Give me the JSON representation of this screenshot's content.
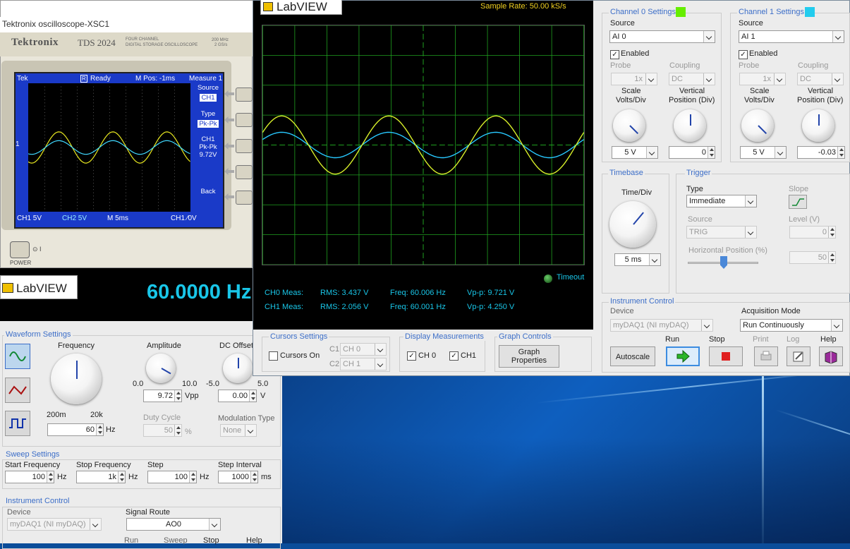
{
  "tek": {
    "window_title": "Tektronix oscilloscope-XSC1",
    "brand": "Tektronix",
    "model": "TDS 2024",
    "model_sub1": "FOUR CHANNEL",
    "model_sub2": "DIGITAL STORAGE OSCILLOSCOPE",
    "spec1": "200 MHz",
    "spec2": "2 GS/s",
    "top_left": "Tek",
    "status": "Ready",
    "mpos": "M Pos: -1ms",
    "measure": "Measure 1",
    "source_lbl": "Source",
    "source_val": "CH1",
    "type_lbl": "Type",
    "type_val": "Pk-Pk",
    "ch1_lbl": "CH1",
    "ch1_type": "Pk-Pk",
    "ch1_val": "9.72V",
    "back": "Back",
    "ch1_scale": "CH1 5V",
    "ch2_scale": "CH2 5V",
    "time_scale": "M 5ms",
    "trig": "CH1 ∕0V",
    "marker": "1",
    "power": "POWER"
  },
  "fgen": {
    "logo": "LabVIEW",
    "freq_display": "60.0000 Hz",
    "waveform_title": "Waveform Settings",
    "frequency_lbl": "Frequency",
    "freq_min": "200m",
    "freq_max": "20k",
    "freq_val": "60",
    "freq_unit": "Hz",
    "amp_lbl": "Amplitude",
    "amp_min": "0.0",
    "amp_max": "10.0",
    "amp_val": "9.72",
    "amp_unit": "Vpp",
    "dc_lbl": "DC Offset",
    "dc_min": "-5.0",
    "dc_max": "5.0",
    "dc_val": "0.00",
    "dc_unit": "V",
    "duty_lbl": "Duty Cycle",
    "duty_val": "50",
    "duty_unit": "%",
    "mod_lbl": "Modulation Type",
    "mod_val": "None",
    "sweep_title": "Sweep Settings",
    "start_lbl": "Start Frequency",
    "start_val": "100",
    "stop_lbl": "Stop Frequency",
    "stop_val": "1k",
    "step_lbl": "Step",
    "step_val": "100",
    "interval_lbl": "Step Interval",
    "interval_val": "1000",
    "hz": "Hz",
    "ms": "ms",
    "ic_title": "Instrument Control",
    "device_lbl": "Device",
    "device_val": "myDAQ1 (NI myDAQ)",
    "route_lbl": "Signal Route",
    "route_val": "AO0",
    "run": "Run",
    "sweep": "Sweep",
    "stop": "Stop",
    "help": "Help"
  },
  "scope": {
    "logo": "LabVIEW",
    "sample_rate": "Sample Rate:  50.00 kS/s",
    "timeout": "Timeout",
    "ch0_meas": "CH0 Meas:",
    "ch1_meas": "CH1 Meas:",
    "ch0_rms": "RMS:  3.437 V",
    "ch0_freq": "Freq:  60.006 Hz",
    "ch0_vpp": "Vp-p:  9.721 V",
    "ch1_rms": "RMS:  2.056 V",
    "ch1_freq": "Freq:  60.001 Hz",
    "ch1_vpp": "Vp-p:  4.250 V",
    "cursors_title": "Cursors Settings",
    "cursors_on": "Cursors On",
    "c1": "C1",
    "c1_val": "CH 0",
    "c2": "C2",
    "c2_val": "CH 1",
    "display_title": "Display Measurements",
    "disp_ch0": "CH 0",
    "disp_ch1": "CH1",
    "graph_title": "Graph Controls",
    "graph_props_1": "Graph",
    "graph_props_2": "Properties",
    "ch0_title": "Channel 0 Settings",
    "ch1_title": "Channel 1 Settings",
    "source_lbl": "Source",
    "ch0_source": "AI 0",
    "ch1_source": "AI 1",
    "enabled": "Enabled",
    "probe": "Probe",
    "coupling": "Coupling",
    "probe_val": "1x",
    "coupling_val": "DC",
    "scale_lbl_1": "Scale",
    "scale_lbl_2": "Volts/Div",
    "vpos_lbl_1": "Vertical",
    "vpos_lbl_2": "Position (Div)",
    "ch0_scale": "5 V",
    "ch0_vpos": "0",
    "ch1_scale": "5 V",
    "ch1_vpos": "-0.03",
    "timebase_title": "Timebase",
    "timediv_lbl": "Time/Div",
    "timediv_val": "5 ms",
    "trigger_title": "Trigger",
    "type_lbl": "Type",
    "type_val": "Immediate",
    "slope_lbl": "Slope",
    "trig_source_lbl": "Source",
    "trig_source_val": "TRIG",
    "level_lbl": "Level (V)",
    "level_val": "0",
    "hpos_lbl": "Horizontal Position (%)",
    "hpos_val": "50",
    "ic_title": "Instrument Control",
    "device_lbl": "Device",
    "device_val": "myDAQ1 (NI myDAQ)",
    "acq_lbl": "Acquisition Mode",
    "acq_val": "Run Continuously",
    "autoscale": "Autoscale",
    "run": "Run",
    "stop": "Stop",
    "print": "Print",
    "log": "Log",
    "help": "Help"
  },
  "colors": {
    "ch0": "#d8f02a",
    "ch1": "#28c8ff",
    "grid": "#1fa01f",
    "ch0_swatch": "#66ee00",
    "ch1_swatch": "#22ccee",
    "accent": "#3c6ec8"
  }
}
